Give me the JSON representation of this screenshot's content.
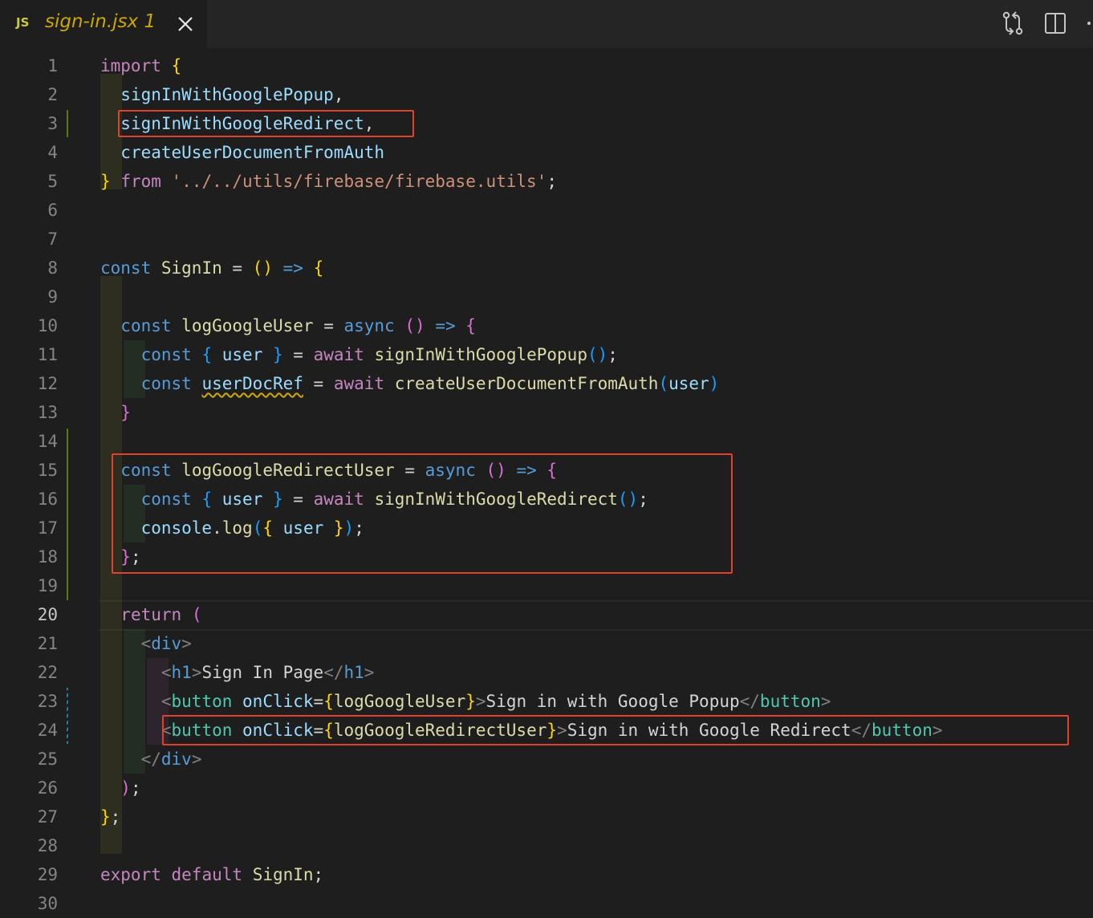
{
  "tab": {
    "icon": "JS",
    "filename": "sign-in.jsx",
    "problems": "1"
  },
  "toolbar": {
    "compare_icon": "git-compare-icon",
    "split_icon": "split-editor-icon"
  },
  "colors": {
    "highlight_box": "#e0412f",
    "added_gutter": "#587c0c",
    "modified_gutter": "#1b81a8"
  },
  "editor": {
    "active_line": 20,
    "lines": [
      [
        [
          "kw",
          "import"
        ],
        [
          "pu",
          " "
        ],
        [
          "b1",
          "{"
        ]
      ],
      [
        [
          "pu",
          "  "
        ],
        [
          "vr",
          "signInWithGooglePopup"
        ],
        [
          "pu",
          ","
        ]
      ],
      [
        [
          "pu",
          "  "
        ],
        [
          "vr",
          "signInWithGoogleRedirect"
        ],
        [
          "pu",
          ","
        ]
      ],
      [
        [
          "pu",
          "  "
        ],
        [
          "vr",
          "createUserDocumentFromAuth"
        ]
      ],
      [
        [
          "b1",
          "}"
        ],
        [
          "pu",
          " "
        ],
        [
          "kw",
          "from"
        ],
        [
          "pu",
          " "
        ],
        [
          "sr",
          "'../../utils/firebase/firebase.utils'"
        ],
        [
          "pu",
          ";"
        ]
      ],
      [],
      [],
      [
        [
          "st",
          "const"
        ],
        [
          "pu",
          " "
        ],
        [
          "fn",
          "SignIn"
        ],
        [
          "pu",
          " = "
        ],
        [
          "b1",
          "()"
        ],
        [
          "pu",
          " "
        ],
        [
          "st",
          "=>"
        ],
        [
          "pu",
          " "
        ],
        [
          "b1",
          "{"
        ]
      ],
      [],
      [
        [
          "pu",
          "  "
        ],
        [
          "st",
          "const"
        ],
        [
          "pu",
          " "
        ],
        [
          "fn",
          "logGoogleUser"
        ],
        [
          "pu",
          " = "
        ],
        [
          "st",
          "async"
        ],
        [
          "pu",
          " "
        ],
        [
          "b2",
          "()"
        ],
        [
          "pu",
          " "
        ],
        [
          "st",
          "=>"
        ],
        [
          "pu",
          " "
        ],
        [
          "b2",
          "{"
        ]
      ],
      [
        [
          "pu",
          "    "
        ],
        [
          "st",
          "const"
        ],
        [
          "pu",
          " "
        ],
        [
          "b3",
          "{"
        ],
        [
          "pu",
          " "
        ],
        [
          "vr",
          "user"
        ],
        [
          "pu",
          " "
        ],
        [
          "b3",
          "}"
        ],
        [
          "pu",
          " = "
        ],
        [
          "kw",
          "await"
        ],
        [
          "pu",
          " "
        ],
        [
          "fn",
          "signInWithGooglePopup"
        ],
        [
          "b3",
          "()"
        ],
        [
          "pu",
          ";"
        ]
      ],
      [
        [
          "pu",
          "    "
        ],
        [
          "st",
          "const"
        ],
        [
          "pu",
          " "
        ],
        [
          "vr sq",
          "userDocRef"
        ],
        [
          "pu",
          " = "
        ],
        [
          "kw",
          "await"
        ],
        [
          "pu",
          " "
        ],
        [
          "fn",
          "createUserDocumentFromAuth"
        ],
        [
          "b3",
          "("
        ],
        [
          "vr",
          "user"
        ],
        [
          "b3",
          ")"
        ]
      ],
      [
        [
          "pu",
          "  "
        ],
        [
          "b2",
          "}"
        ]
      ],
      [],
      [
        [
          "pu",
          "  "
        ],
        [
          "st",
          "const"
        ],
        [
          "pu",
          " "
        ],
        [
          "fn",
          "logGoogleRedirectUser"
        ],
        [
          "pu",
          " = "
        ],
        [
          "st",
          "async"
        ],
        [
          "pu",
          " "
        ],
        [
          "b2",
          "()"
        ],
        [
          "pu",
          " "
        ],
        [
          "st",
          "=>"
        ],
        [
          "pu",
          " "
        ],
        [
          "b2",
          "{"
        ]
      ],
      [
        [
          "pu",
          "    "
        ],
        [
          "st",
          "const"
        ],
        [
          "pu",
          " "
        ],
        [
          "b3",
          "{"
        ],
        [
          "pu",
          " "
        ],
        [
          "vr",
          "user"
        ],
        [
          "pu",
          " "
        ],
        [
          "b3",
          "}"
        ],
        [
          "pu",
          " = "
        ],
        [
          "kw",
          "await"
        ],
        [
          "pu",
          " "
        ],
        [
          "fn",
          "signInWithGoogleRedirect"
        ],
        [
          "b3",
          "()"
        ],
        [
          "pu",
          ";"
        ]
      ],
      [
        [
          "pu",
          "    "
        ],
        [
          "vr",
          "console"
        ],
        [
          "pu",
          "."
        ],
        [
          "fn",
          "log"
        ],
        [
          "b3",
          "("
        ],
        [
          "b1",
          "{"
        ],
        [
          "pu",
          " "
        ],
        [
          "vr",
          "user"
        ],
        [
          "pu",
          " "
        ],
        [
          "b1",
          "}"
        ],
        [
          "b3",
          ")"
        ],
        [
          "pu",
          ";"
        ]
      ],
      [
        [
          "pu",
          "  "
        ],
        [
          "b2",
          "}"
        ],
        [
          "pu",
          ";"
        ]
      ],
      [],
      [
        [
          "pu",
          "  "
        ],
        [
          "kw",
          "return"
        ],
        [
          "pu",
          " "
        ],
        [
          "b2",
          "("
        ]
      ],
      [
        [
          "pu",
          "    "
        ],
        [
          "an",
          "<"
        ],
        [
          "tg",
          "div"
        ],
        [
          "an",
          ">"
        ]
      ],
      [
        [
          "pu",
          "      "
        ],
        [
          "an",
          "<"
        ],
        [
          "tg",
          "h1"
        ],
        [
          "an",
          ">"
        ],
        [
          "tx",
          "Sign In Page"
        ],
        [
          "an",
          "</"
        ],
        [
          "tg",
          "h1"
        ],
        [
          "an",
          ">"
        ]
      ],
      [
        [
          "pu",
          "      "
        ],
        [
          "an",
          "<"
        ],
        [
          "ty",
          "button"
        ],
        [
          "pu",
          " "
        ],
        [
          "vr",
          "onClick"
        ],
        [
          "pu",
          "="
        ],
        [
          "b1",
          "{"
        ],
        [
          "fn",
          "logGoogleUser"
        ],
        [
          "b1",
          "}"
        ],
        [
          "an",
          ">"
        ],
        [
          "tx",
          "Sign in with Google Popup"
        ],
        [
          "an",
          "</"
        ],
        [
          "ty",
          "button"
        ],
        [
          "an",
          ">"
        ]
      ],
      [
        [
          "pu",
          "      "
        ],
        [
          "an",
          "<"
        ],
        [
          "ty",
          "button"
        ],
        [
          "pu",
          " "
        ],
        [
          "vr",
          "onClick"
        ],
        [
          "pu",
          "="
        ],
        [
          "b1",
          "{"
        ],
        [
          "fn",
          "logGoogleRedirectUser"
        ],
        [
          "b1",
          "}"
        ],
        [
          "an",
          ">"
        ],
        [
          "tx",
          "Sign in with Google Redirect"
        ],
        [
          "an",
          "</"
        ],
        [
          "ty",
          "button"
        ],
        [
          "an",
          ">"
        ]
      ],
      [
        [
          "pu",
          "    "
        ],
        [
          "an",
          "</"
        ],
        [
          "tg",
          "div"
        ],
        [
          "an",
          ">"
        ]
      ],
      [
        [
          "pu",
          "  "
        ],
        [
          "b2",
          ")"
        ],
        [
          "pu",
          ";"
        ]
      ],
      [
        [
          "b1",
          "}"
        ],
        [
          "pu",
          ";"
        ]
      ],
      [],
      [
        [
          "kw",
          "export"
        ],
        [
          "pu",
          " "
        ],
        [
          "kw",
          "default"
        ],
        [
          "pu",
          " "
        ],
        [
          "fn",
          "SignIn"
        ],
        [
          "pu",
          ";"
        ]
      ],
      []
    ]
  }
}
